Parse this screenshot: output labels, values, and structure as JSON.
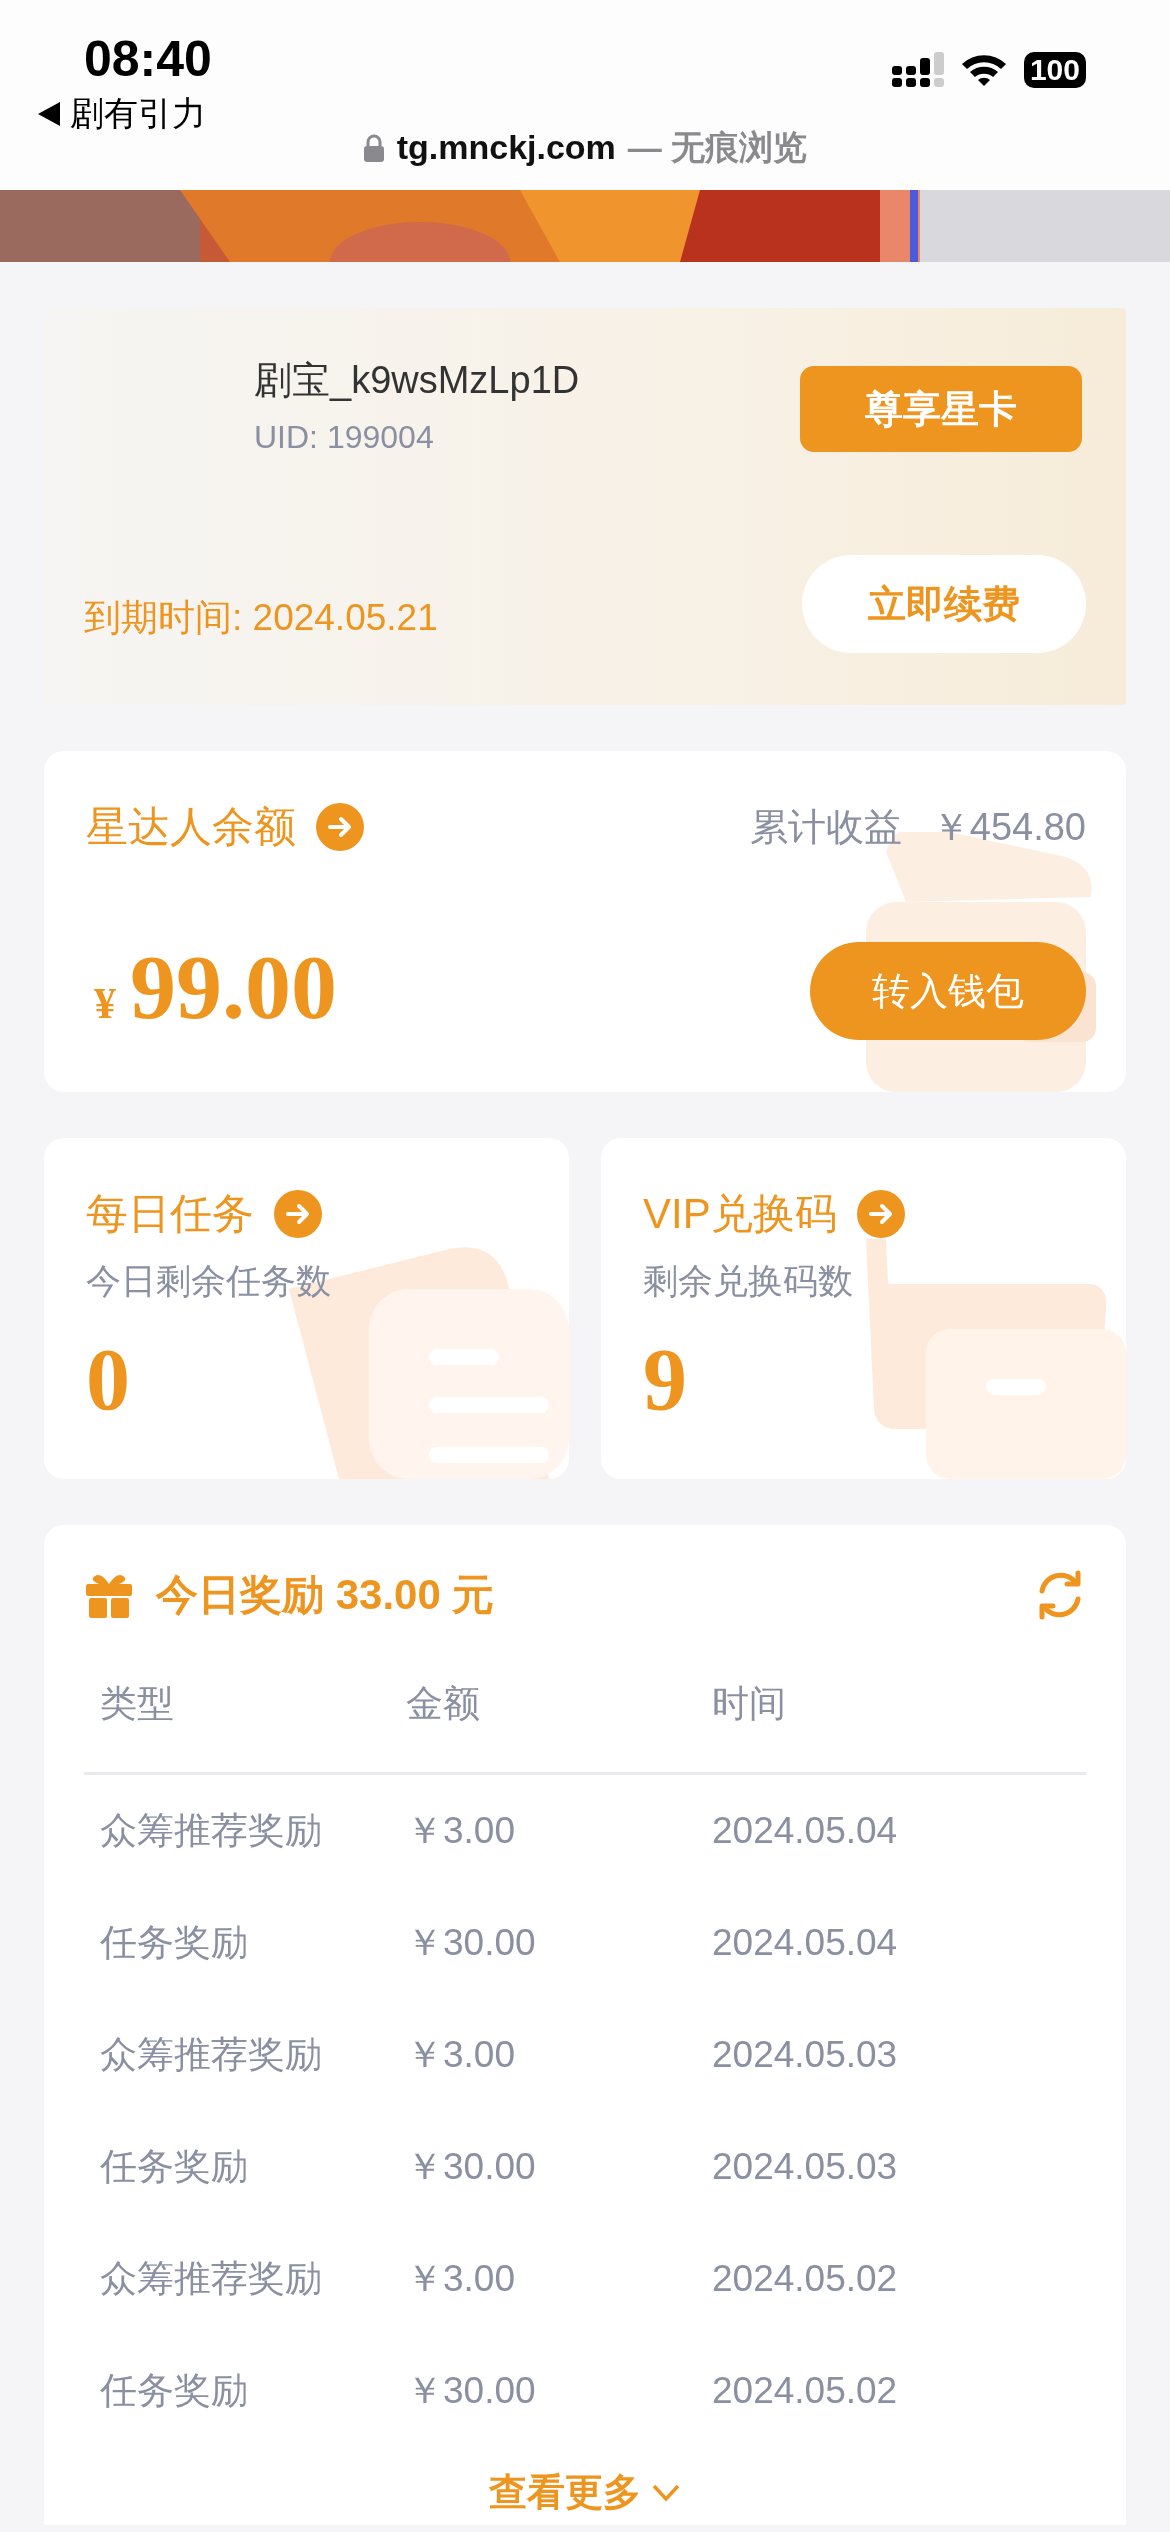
{
  "status_bar": {
    "time": "08:40",
    "back_label": "剧有引力",
    "battery": "100"
  },
  "address_bar": {
    "url": "tg.mnckj.com",
    "mode": "— 无痕浏览"
  },
  "profile": {
    "username": "剧宝_k9wsMzLp1D",
    "uid": "UID: 199004",
    "card_button": "尊享星卡",
    "expiry": "到期时间: 2024.05.21",
    "renew_button": "立即续费"
  },
  "balance": {
    "title": "星达人余额",
    "total_label": "累计收益",
    "total_value": "￥454.80",
    "currency": "¥",
    "amount": "99.00",
    "button": "转入钱包"
  },
  "stats": [
    {
      "kind": "task",
      "title": "每日任务",
      "subtitle": "今日剩余任务数",
      "value": "0"
    },
    {
      "kind": "code",
      "title": "VIP兑换码",
      "subtitle": "剩余兑换码数",
      "value": "9"
    }
  ],
  "rewards": {
    "title": "今日奖励 33.00 元",
    "columns": [
      "类型",
      "金额",
      "时间"
    ],
    "rows": [
      [
        "众筹推荐奖励",
        "￥3.00",
        "2024.05.04"
      ],
      [
        "任务奖励",
        "￥30.00",
        "2024.05.04"
      ],
      [
        "众筹推荐奖励",
        "￥3.00",
        "2024.05.03"
      ],
      [
        "任务奖励",
        "￥30.00",
        "2024.05.03"
      ],
      [
        "众筹推荐奖励",
        "￥3.00",
        "2024.05.02"
      ],
      [
        "任务奖励",
        "￥30.00",
        "2024.05.02"
      ]
    ],
    "more": "查看更多"
  }
}
